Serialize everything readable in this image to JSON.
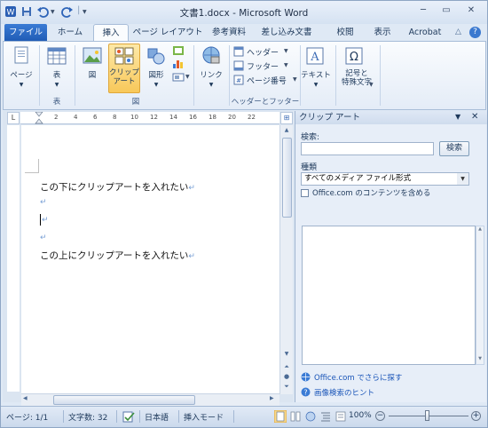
{
  "window": {
    "title": "文書1.docx - Microsoft Word"
  },
  "tabs": [
    "ファイル",
    "ホーム",
    "挿入",
    "ページ レイアウト",
    "参考資料",
    "差し込み文書",
    "校閲",
    "表示",
    "Acrobat"
  ],
  "ribbon": {
    "page": "ページ",
    "table": "表",
    "figure": "図",
    "clipart": "クリップ\nアート",
    "shapes": "図形",
    "link": "リンク",
    "header": "ヘッダー",
    "footer": "フッター",
    "pagenum": "ページ番号",
    "text": "テキスト",
    "symbol": "記号と\n特殊文字",
    "group_table": "表",
    "group_figure": "図",
    "group_headerfooter": "ヘッダーとフッター"
  },
  "ruler": [
    "2",
    "4",
    "6",
    "8",
    "10",
    "12",
    "14",
    "16",
    "18",
    "20",
    "22"
  ],
  "document": {
    "line1": "この下にクリップアートを入れたい",
    "line2": "この上にクリップアートを入れたい",
    "para_mark": "↵"
  },
  "pane": {
    "title": "クリップ アート",
    "search_label": "検索:",
    "search_value": "",
    "search_button": "検索",
    "type_label": "種類",
    "type_value": "すべてのメディア ファイル形式",
    "office_checkbox": "Office.com のコンテンツを含める",
    "office_checked": false,
    "link_more": "Office.com でさらに探す",
    "link_hint": "画像検索のヒント"
  },
  "status": {
    "page": "ページ: 1/1",
    "words": "文字数: 32",
    "lang": "日本語",
    "mode": "挿入モード",
    "zoom": "100%"
  },
  "colors": {
    "file_tab": "#2a6bc6",
    "accent": "#1a55b8"
  }
}
